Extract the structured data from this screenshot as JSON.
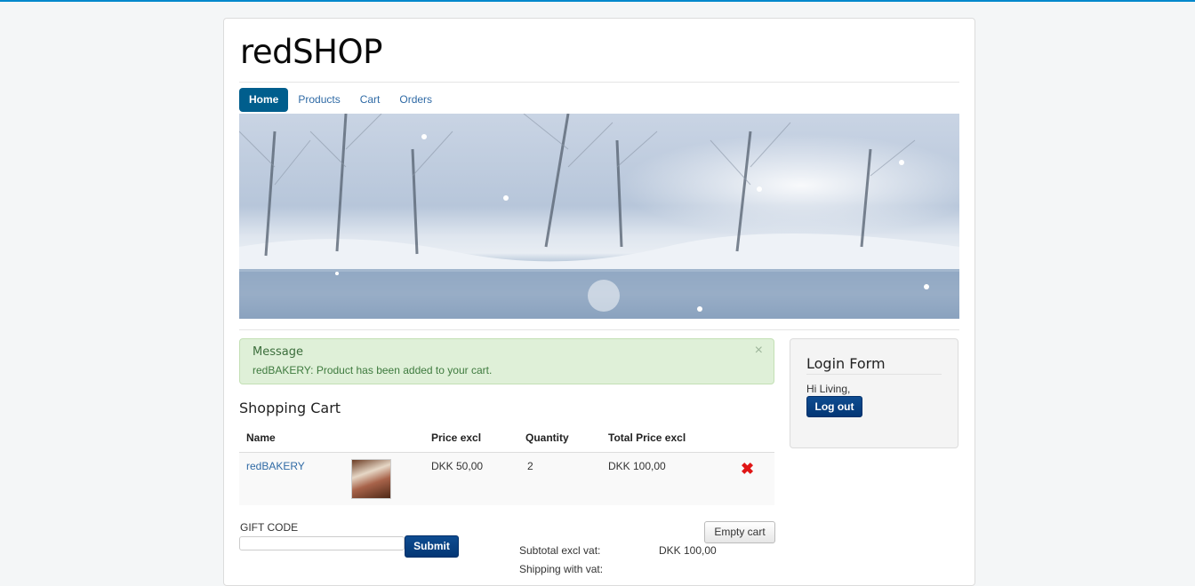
{
  "site": {
    "brand": "redSHOP"
  },
  "nav": {
    "items": [
      "Home",
      "Products",
      "Cart",
      "Orders"
    ],
    "active": "Home"
  },
  "message": {
    "title": "Message",
    "text": "redBAKERY: Product has been added to your cart.",
    "close": "×"
  },
  "cart": {
    "title": "Shopping Cart",
    "columns": {
      "name": "Name",
      "price": "Price excl",
      "quantity": "Quantity",
      "total": "Total Price excl"
    },
    "rows": [
      {
        "name": "redBAKERY",
        "price": "DKK 50,00",
        "quantity": "2",
        "total": "DKK 100,00",
        "delete_icon": "red-x-icon"
      }
    ],
    "gift_label": "GIFT CODE",
    "submit_label": "Submit",
    "empty_label": "Empty cart",
    "subtotal_label": "Subtotal excl vat:",
    "subtotal_value": "DKK 100,00",
    "shipping_label": "Shipping with vat:"
  },
  "login": {
    "title": "Login Form",
    "greeting": "Hi Living,",
    "logout_label": "Log out"
  },
  "colors": {
    "accent": "#005e8d",
    "link": "#2f6aa5",
    "alert_bg": "#dff0d8",
    "button": "#043775",
    "delete": "#e01616"
  }
}
